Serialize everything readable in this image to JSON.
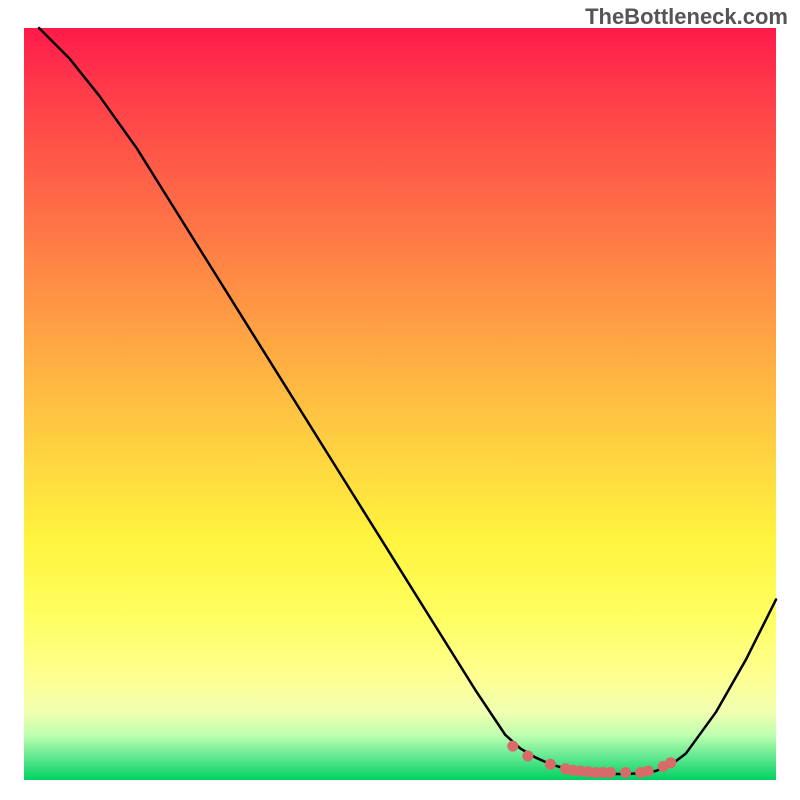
{
  "watermark": "TheBottleneck.com",
  "chart_data": {
    "type": "line",
    "title": "",
    "xlabel": "",
    "ylabel": "",
    "xlim": [
      0,
      100
    ],
    "ylim": [
      0,
      100
    ],
    "series": [
      {
        "name": "curve",
        "color": "#000000",
        "x": [
          2,
          6,
          10,
          15,
          20,
          25,
          30,
          35,
          40,
          45,
          50,
          55,
          60,
          64,
          66,
          68,
          70,
          72,
          74,
          76,
          78,
          80,
          82,
          84,
          86,
          88,
          92,
          96,
          100
        ],
        "y": [
          100,
          96,
          91,
          84,
          76,
          68,
          60,
          52,
          44,
          36,
          28,
          20,
          12,
          6,
          4.2,
          3,
          2.1,
          1.5,
          1.1,
          0.9,
          0.8,
          0.8,
          0.9,
          1.2,
          2,
          3.5,
          9,
          16,
          24
        ]
      },
      {
        "name": "dots",
        "color": "#d86a6a",
        "type": "scatter",
        "x": [
          65,
          67,
          70,
          72,
          73,
          74,
          75,
          76,
          77,
          78,
          80,
          82,
          83,
          85,
          86
        ],
        "y": [
          4.5,
          3.2,
          2.1,
          1.5,
          1.3,
          1.2,
          1.1,
          1.0,
          1.0,
          1.0,
          1.0,
          1.0,
          1.2,
          1.8,
          2.3
        ]
      }
    ]
  }
}
